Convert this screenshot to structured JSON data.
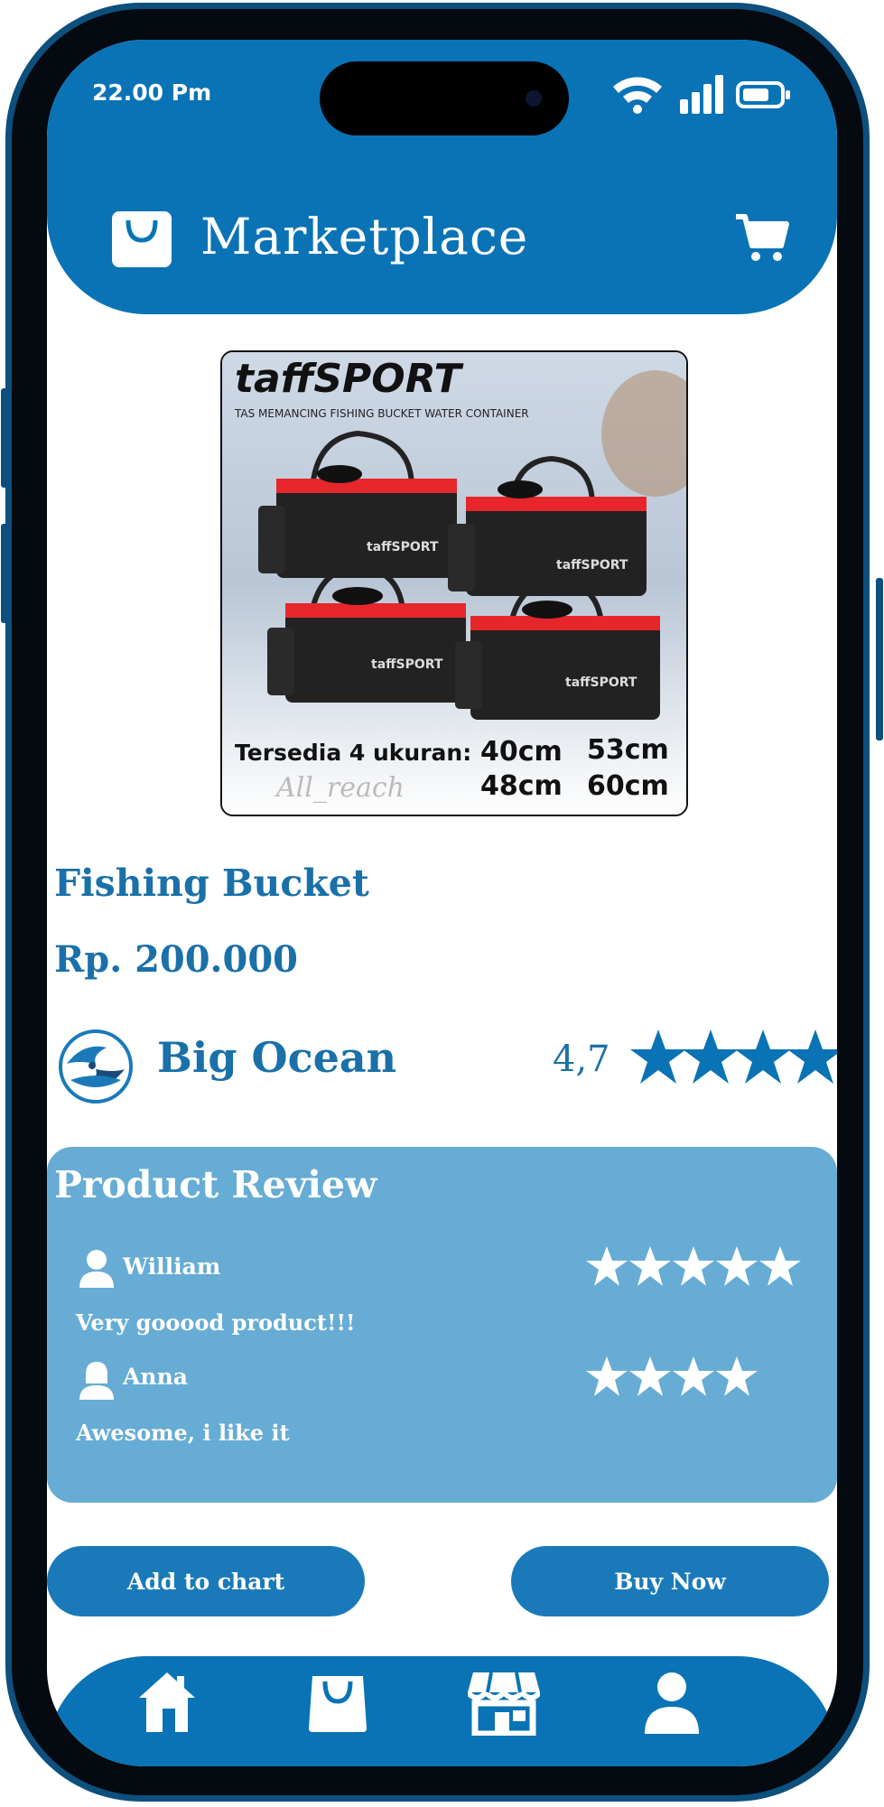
{
  "status_bar": {
    "time": "22.00 Pm"
  },
  "header": {
    "title": "Marketplace"
  },
  "product": {
    "image": {
      "brand": "taffSPORT",
      "subtitle": "TAS MEMANCING FISHING BUCKET WATER CONTAINER",
      "sizes_label": "Tersedia 4 ukuran:",
      "sizes": [
        "40cm",
        "53cm",
        "48cm",
        "60cm"
      ],
      "bag_brand": "taffSPORT",
      "watermark": "All_reach"
    },
    "name": "Fishing Bucket",
    "price": "Rp. 200.000"
  },
  "seller": {
    "name": "Big Ocean",
    "rating": "4,7"
  },
  "reviews": {
    "title": "Product Review",
    "items": [
      {
        "user": "William",
        "text": "Very gooood product!!!",
        "stars": 5
      },
      {
        "user": "Anna",
        "text": "Awesome, i like it",
        "stars": 4
      }
    ]
  },
  "actions": {
    "add_to_cart": "Add to chart",
    "buy_now": "Buy Now"
  },
  "bottom_nav": {
    "items": [
      {
        "id": "home",
        "icon": "home-icon"
      },
      {
        "id": "shop-bag",
        "icon": "bag-icon"
      },
      {
        "id": "store",
        "icon": "store-icon"
      },
      {
        "id": "profile",
        "icon": "user-icon"
      }
    ]
  },
  "colors": {
    "primary": "#0a73b5",
    "text_blue": "#1a70a8",
    "review_bg": "#66acd4",
    "button": "#1a7ab9",
    "frame": "#0d4f7d",
    "bag_red": "#e6262b"
  }
}
